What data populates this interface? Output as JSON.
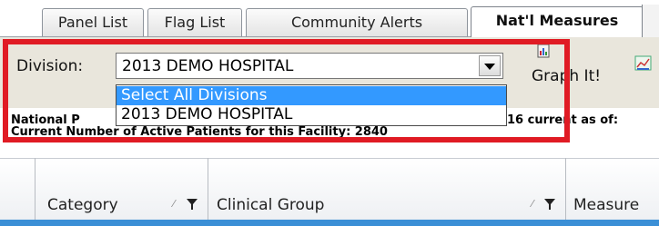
{
  "tabs": [
    {
      "label": "Panel List"
    },
    {
      "label": "Flag List"
    },
    {
      "label": "Community Alerts"
    },
    {
      "label": "Nat'l Measures"
    }
  ],
  "toolbar": {
    "division_label": "Division:",
    "division_value": "2013 DEMO HOSPITAL",
    "graph_label": "Graph It!"
  },
  "dropdown": {
    "options": [
      "Select All Divisions",
      "2013 DEMO HOSPITAL"
    ]
  },
  "info": {
    "line1_start": "National P",
    "line1_end": "16 current as of:",
    "line2": "Current Number of Active Patients for this Facility: 2840"
  },
  "grid": {
    "columns": [
      "Category",
      "Clinical Group",
      "Measure"
    ]
  },
  "colors": {
    "highlight": "#e01b24",
    "selection": "#3399ff",
    "toolbar_bg": "#e9e6dc"
  }
}
